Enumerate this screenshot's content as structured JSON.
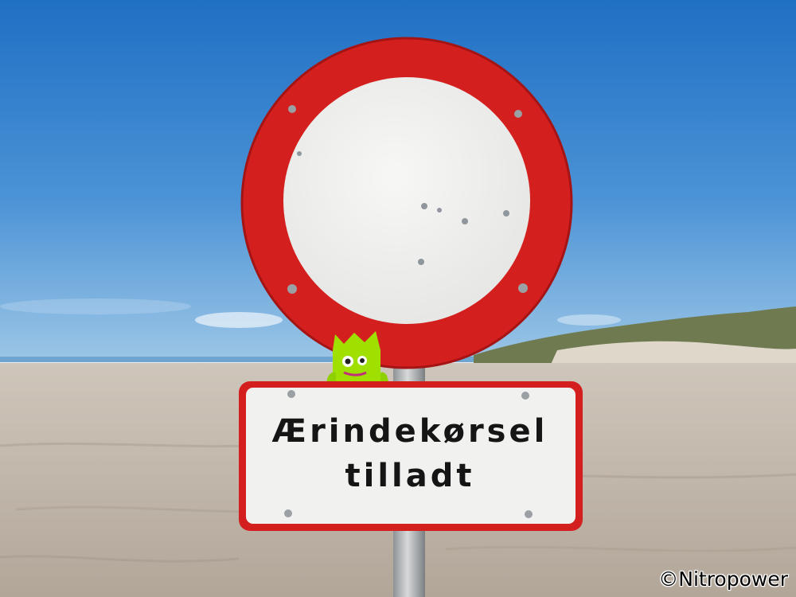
{
  "sign": {
    "line1": "Ærindekørsel",
    "line2": "tilladt"
  },
  "watermark": {
    "text": "©Nitropower"
  },
  "colors": {
    "sky_top": "#1f6fc4",
    "sky_bottom": "#8fc0e6",
    "sand": "#b9aea2",
    "sign_red": "#d41f1f",
    "sign_white": "#f1f1ef",
    "mascot_green": "#9fe000"
  }
}
